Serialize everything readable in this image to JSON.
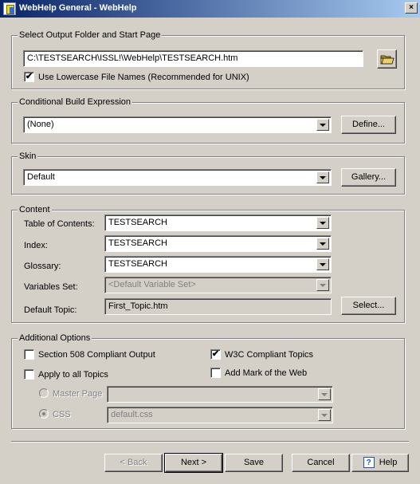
{
  "window": {
    "title": "WebHelp General - WebHelp",
    "close_glyph": "×"
  },
  "output": {
    "group_label": "Select Output Folder and Start Page",
    "path": "C:\\TESTSEARCH\\ISSL!\\WebHelp\\TESTSEARCH.htm",
    "lowercase_label": "Use Lowercase File Names (Recommended for UNIX)",
    "lowercase_checked": "✔"
  },
  "conditional": {
    "group_label": "Conditional Build Expression",
    "value": "(None)",
    "define_label": "Define..."
  },
  "skin": {
    "group_label": "Skin",
    "value": "Default",
    "gallery_label": "Gallery..."
  },
  "content": {
    "group_label": "Content",
    "toc_label": "Table of Contents:",
    "toc_value": "TESTSEARCH",
    "index_label": "Index:",
    "index_value": "TESTSEARCH",
    "glossary_label": "Glossary:",
    "glossary_value": "TESTSEARCH",
    "variables_label": "Variables Set:",
    "variables_value": "<Default Variable Set>",
    "default_topic_label": "Default Topic:",
    "default_topic_value": "First_Topic.htm",
    "select_label": "Select..."
  },
  "options": {
    "group_label": "Additional Options",
    "section508_label": "Section 508 Compliant Output",
    "w3c_label": "W3C Compliant Topics",
    "w3c_checked": "✔",
    "apply_all_label": "Apply to all Topics",
    "mark_web_label": "Add Mark of the Web",
    "master_page_label": "Master Page",
    "master_page_value": "",
    "css_label": "CSS",
    "css_value": "default.css"
  },
  "footer": {
    "back_label": "< Back",
    "next_label": "Next >",
    "save_label": "Save",
    "cancel_label": "Cancel",
    "help_label": "Help",
    "help_glyph": "?"
  },
  "colors": {
    "dialog_bg": "#d4d0c8",
    "titlebar_start": "#0a246a",
    "titlebar_end": "#a6caf0"
  }
}
